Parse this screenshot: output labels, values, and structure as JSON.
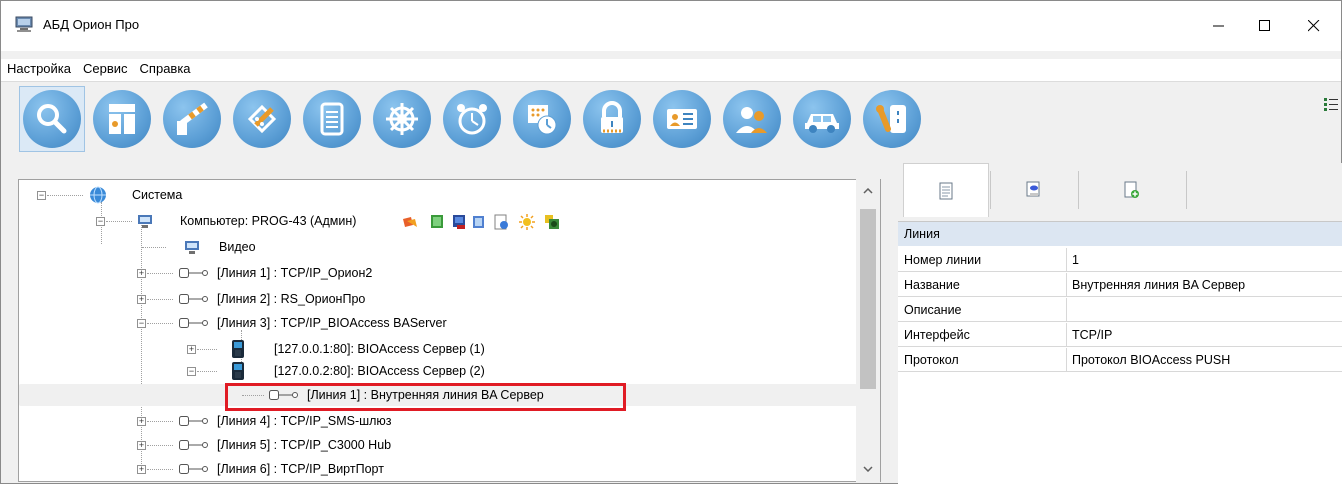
{
  "window": {
    "title": "АБД Орион Про"
  },
  "menu": [
    "Настройка",
    "Сервис",
    "Справка"
  ],
  "toolbar": {
    "buttons": [
      "search-icon",
      "devices-icon",
      "barrier-icon",
      "editor-icon",
      "document-icon",
      "helm-icon",
      "alarm-clock-icon",
      "schedule-icon",
      "lock-icon",
      "id-card-icon",
      "users-icon",
      "car-icon",
      "key-icon"
    ],
    "active_index": 0,
    "accent": "#5c9fd6"
  },
  "tree": {
    "root": "Система",
    "computer": "Компьютер: PROG-43 (Админ)",
    "video": "Видео",
    "line1": "[Линия 1] : TCP/IP_Орион2",
    "line2": "[Линия 2] : RS_ОрионПро",
    "line3": "[Линия 3] : TCP/IP_BIOAccess BAServer",
    "bio1": "[127.0.0.1:80]: BIOAccess Сервер (1)",
    "bio2": "[127.0.0.2:80]: BIOAccess Сервер (2)",
    "inner_line": "[Линия 1] : Внутренняя линия BA Сервер",
    "line4": "[Линия 4] : TCP/IP_SMS-шлюз",
    "line5": "[Линия 5] : TCP/IP_C3000 Hub",
    "line6": "[Линия 6] : TCP/IP_ВиртПорт",
    "highlight_color": "#e01b24"
  },
  "properties": {
    "tabs": [
      "properties-tab",
      "events-tab",
      "add-tab"
    ],
    "header": "Линия",
    "rows": [
      {
        "key": "Номер линии",
        "value": "1"
      },
      {
        "key": "Название",
        "value": "Внутренняя линия BA Сервер"
      },
      {
        "key": "Описание",
        "value": ""
      },
      {
        "key": "Интерфейс",
        "value": "TCP/IP"
      },
      {
        "key": "Протокол",
        "value": "Протокол BIOAccess PUSH"
      }
    ]
  }
}
